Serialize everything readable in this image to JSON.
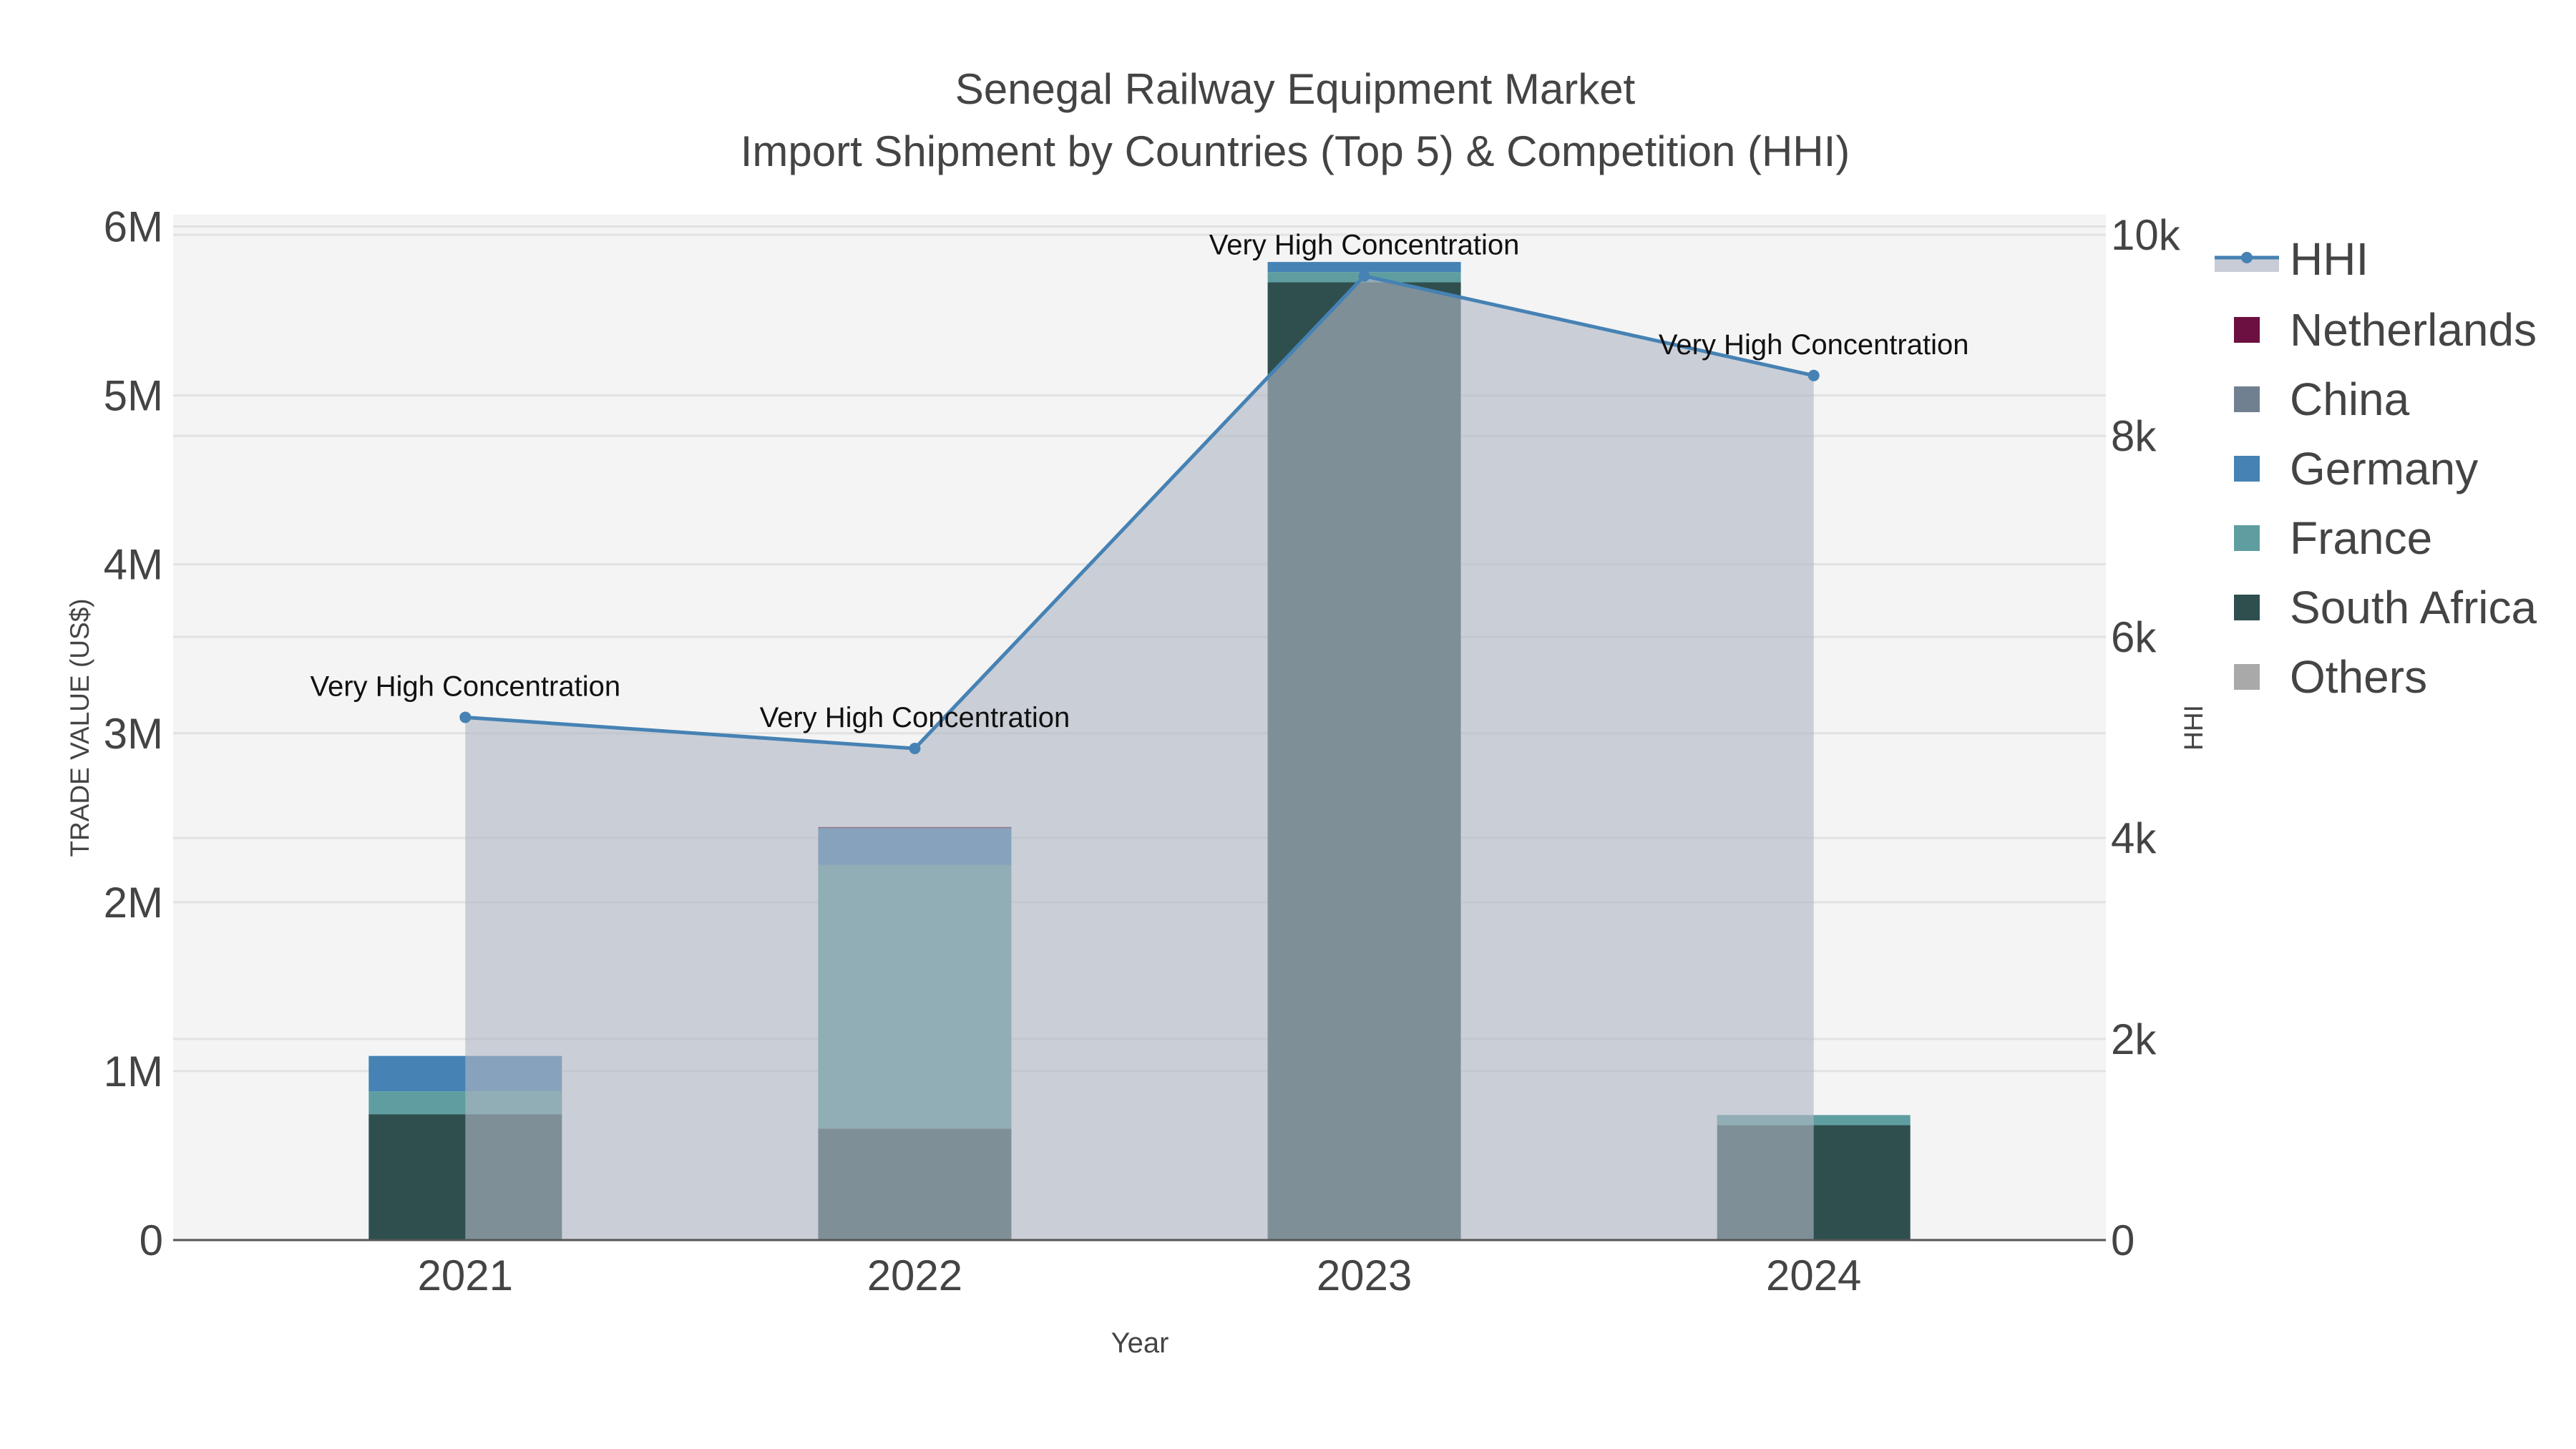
{
  "chart_data": {
    "type": "bar",
    "title_line1": "Senegal Railway Equipment Market",
    "title_line2": "Import Shipment by Countries (Top 5) & Competition (HHI)",
    "xlabel": "Year",
    "ylabel": "TRADE VALUE (US$)",
    "y2label": "HHI",
    "categories": [
      "2021",
      "2022",
      "2023",
      "2024"
    ],
    "ylim": [
      0,
      6070000
    ],
    "y2lim": [
      0,
      10200
    ],
    "yticks": [
      0,
      1000000,
      2000000,
      3000000,
      4000000,
      5000000,
      6000000
    ],
    "ytick_labels": [
      "0",
      "1M",
      "2M",
      "3M",
      "4M",
      "5M",
      "6M"
    ],
    "y2ticks": [
      0,
      2000,
      4000,
      6000,
      8000,
      10000
    ],
    "y2tick_labels": [
      "0",
      "2k",
      "4k",
      "6k",
      "8k",
      "10k"
    ],
    "series": [
      {
        "name": "South Africa",
        "color": "#2F4F4F",
        "values": [
          745000,
          660000,
          5670000,
          680000
        ]
      },
      {
        "name": "France",
        "color": "#5F9EA0",
        "values": [
          135000,
          1560000,
          60000,
          60000
        ]
      },
      {
        "name": "Germany",
        "color": "#4682B4",
        "values": [
          210000,
          220000,
          60000,
          0
        ]
      },
      {
        "name": "China",
        "color": "#708090",
        "values": [
          0,
          0,
          0,
          0
        ]
      },
      {
        "name": "Netherlands",
        "color": "#6B1040",
        "values": [
          0,
          5000,
          0,
          0
        ]
      },
      {
        "name": "Others",
        "color": "#A9A9A9",
        "values": [
          0,
          0,
          0,
          0
        ]
      }
    ],
    "hhi": {
      "name": "HHI",
      "color": "#4682B4",
      "values": [
        5200,
        4890,
        9590,
        8600
      ],
      "annotations": [
        "Very High Concentration",
        "Very High Concentration",
        "Very High Concentration",
        "Very High Concentration"
      ]
    },
    "legend_order": [
      "HHI",
      "Netherlands",
      "China",
      "Germany",
      "France",
      "South Africa",
      "Others"
    ],
    "legend_placement": "right",
    "grid": true
  }
}
